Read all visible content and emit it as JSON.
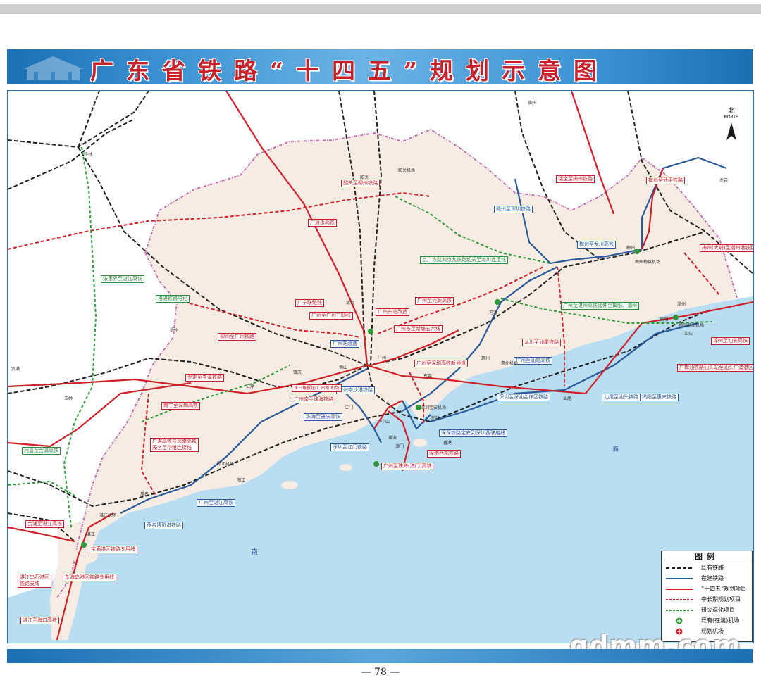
{
  "title": "广东省铁路“十四五”规划示意图",
  "compass": {
    "cn": "北",
    "en": "NORTH"
  },
  "page_number": "— 78 —",
  "watermark": "gdmm.com",
  "legend": {
    "title": "图例",
    "items": [
      {
        "label": "既有铁路",
        "style": "existing",
        "color": "#222222"
      },
      {
        "label": "在建铁路",
        "style": "construction",
        "color": "#2a5a9a"
      },
      {
        "label": "“十四五”规划项目",
        "style": "plan14",
        "color": "#d0202a"
      },
      {
        "label": "中长期规划项目",
        "style": "longterm",
        "color": "#d0202a"
      },
      {
        "label": "研究深化项目",
        "style": "research",
        "color": "#2e9a3a"
      },
      {
        "label": "既有(在建)机场",
        "style": "airport-existing",
        "color": "#2e9a3a"
      },
      {
        "label": "规划机场",
        "style": "airport-planned",
        "color": "#d0202a"
      }
    ]
  },
  "colors": {
    "land": "#f6ece3",
    "sea": "#b9def1",
    "red": "#d0202a",
    "blue": "#2a5a9a",
    "green": "#2e9a3a"
  },
  "labels": {
    "shaoguan_liuzhou": "韶关至柳州铁路",
    "guangqing_yong": "广清永高铁",
    "meizhou_wuping": "梅州至武平铁路",
    "ruijin_meizhou": "瑞金至梅州铁路",
    "ganzhou_shenzhen": "赣州至深圳铁路",
    "meizhou_longchuan": "梅州至龙川高铁",
    "meizhou_chaozhou": "梅州(大埔)至潮州港铁路",
    "jingjiu_ganshao": "京广铁路和京九铁路韶关至龙川连接线",
    "zhanghe_zhanjiang": "张家界至湛江高铁",
    "luozhan_elec": "洛湛铁路电化",
    "guangning_link": "广宁联络线",
    "guangzhou_sanjiang": "广州至广州三四线",
    "guangzhou_dongzhan": "广州东站改造",
    "guangzhou_heyuan": "广州至河源高铁",
    "guangzhou_xintang": "广州东至新塘五六线",
    "guangzhou_station": "广州站改造",
    "liuzhou_guangzhou": "柳州至广州铁路",
    "guangzhou_shanwei": "广州至汕尾高铁",
    "longchuan_shanwei": "龙川至汕尾铁路",
    "guangzhou_jieyang": "广州至湛州高铁延伸至揭阳、潮州",
    "zhangzhou_shantou": "漳州至汕头高铁",
    "guangmeishan": "广梅汕铁路汕头站至汕头广澳港区铁路",
    "guangzhou_shenzhen_new": "广州至深圳高铁新通道",
    "luoding_cenxi": "罗定至岑溪铁路",
    "nanning_zhenjiang": "南宁至深圳高铁",
    "gaozhou_maoming": "广湛高铁与深南高铁\n茂名至华港连接线",
    "guangzhou_zhuhai_gold": "广州南至珠海铁路",
    "guangzhou_zhaoqing": "广州南沙港铁路",
    "zhuhai_zhaoqing": "珠海至肇庆高铁",
    "shenzhen_jiangmen": "深圳至江门铁路",
    "shenzhen_shanwei": "深圳至深汕合作区铁路",
    "shanwei_shantou": "汕尾至汕头铁路",
    "jieyang_huilai": "揭阳至惠来铁路",
    "shenzhen_airport": "深深铁路宝安到深圳西联络线",
    "shenzhen_west": "深港西部铁路",
    "guangzhou_zhuhai_macau": "广州至珠海(澳门)高铁",
    "guangzhou_zhanjiang": "广州至湛江高铁",
    "maoming_bohe": "茂名博贺港铁路",
    "hepu_zhanjiang": "合浦至湛江高铁",
    "baoman_port": "宝满港区铁路专用线",
    "donghaidao": "东海岛港区铁路专用线",
    "zhanjiang_wushi": "湛江乌石港区\n铁路支线",
    "zhanjiang_haikou": "湛江至海口高铁",
    "hechuan_yulin": "河唇至合浦高铁",
    "zhuhai_airport_link": "珠三角枢纽(广州新)机场"
  },
  "cities": {
    "shaoguan": "韶关",
    "qingyuan": "清远",
    "heyuan": "河源",
    "meizhou": "梅州",
    "chaozhou": "潮州",
    "shantou": "汕头",
    "jieyang": "揭阳",
    "shanwei": "汕尾",
    "huizhou": "惠州",
    "dongguan": "东莞",
    "shenzhen": "深圳",
    "guangzhou": "广州",
    "foshan": "佛山",
    "zhaoqing": "肇庆",
    "yunfu": "云浮",
    "jiangmen": "江门",
    "zhongshan": "中山",
    "zhuhai": "珠海",
    "macau": "澳门",
    "hongkong": "香港",
    "yangjiang": "阳江",
    "maoming": "茂名",
    "zhanjiang": "湛江",
    "guilin": "桂林",
    "wuzhou": "梧州",
    "yulin": "玉林",
    "guigang": "贵港",
    "ganzhou": "赣州",
    "longyan": "龙岩",
    "meixian_airport": "梅州梅县机场",
    "jieyang_airport": "揭阳潮汕机场",
    "zhanjiang_airport": "湛江机场",
    "shenzhen_airport": "深圳宝安机场",
    "huizhou_airport": "惠州机场",
    "shaoguan_airport": "韶关机场",
    "foshan_airport": "珠三角枢纽(广州新)机场",
    "yangjiang_airport": "阳江机场"
  },
  "sea_labels": {
    "south_sea_1": "南",
    "south_sea_2": "海"
  }
}
